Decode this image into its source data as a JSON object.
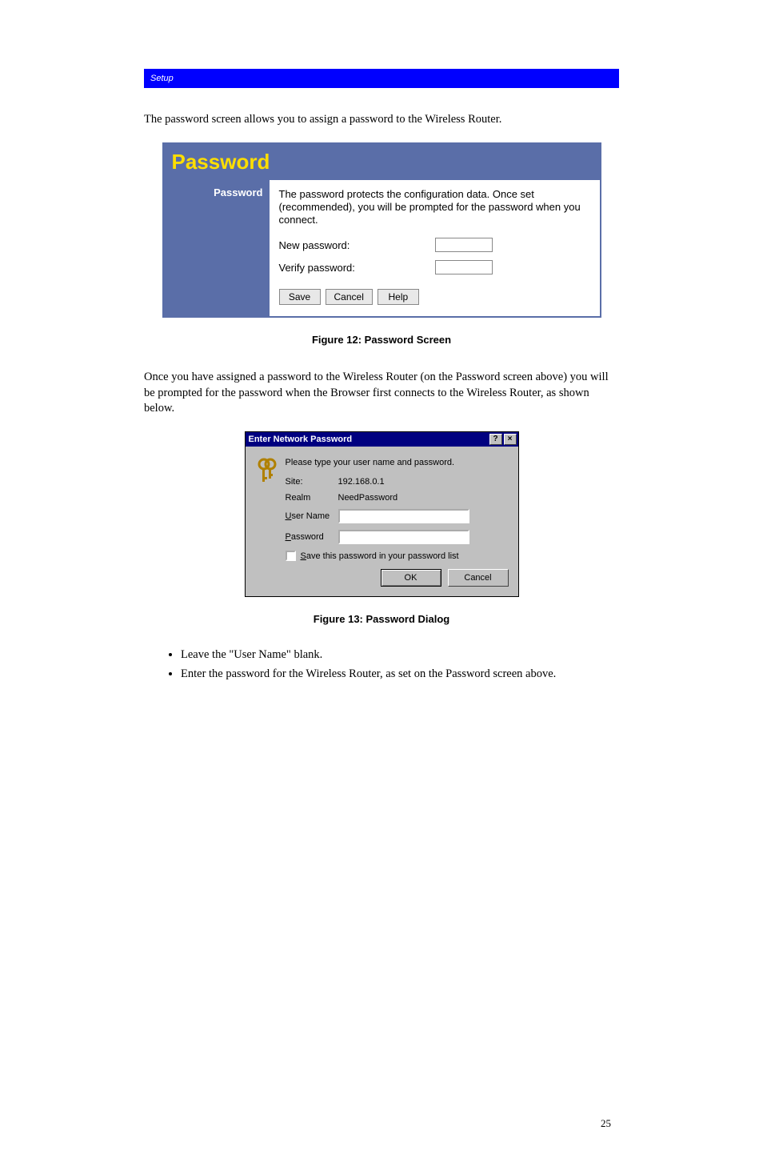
{
  "header": {
    "left": "Setup",
    "right": ""
  },
  "intro": "The password screen allows you to assign a password to the Wireless Router.",
  "password_panel": {
    "title": "Password",
    "section_label": "Password",
    "description": "The password protects the configuration data. Once set (recommended), you will be prompted for the password when you connect.",
    "new_label": "New password:",
    "verify_label": "Verify password:",
    "buttons": {
      "save": "Save",
      "cancel": "Cancel",
      "help": "Help"
    }
  },
  "caption1": "Figure 12: Password Screen",
  "after1": "Once you have assigned a password to the Wireless Router (on the Password screen above) you will be prompted for the password when the Browser first connects to the Wireless Router, as shown below.",
  "dialog": {
    "title": "Enter Network Password",
    "prompt": "Please type your user name and password.",
    "site_label": "Site:",
    "site_value": "192.168.0.1",
    "realm_label": "Realm",
    "realm_value": "NeedPassword",
    "user_label_pre": "U",
    "user_label_rest": "ser Name",
    "pass_label_pre": "P",
    "pass_label_rest": "assword",
    "save_chk_pre": "S",
    "save_chk_rest": "ave this password in your password list",
    "ok": "OK",
    "cancel": "Cancel",
    "help_btn": "?",
    "close_btn": "×"
  },
  "caption2": "Figure 13: Password Dialog",
  "bullets": [
    "Leave the \"User Name\" blank.",
    "Enter the password for the Wireless Router, as set on the Password screen above."
  ],
  "page_number": "25"
}
